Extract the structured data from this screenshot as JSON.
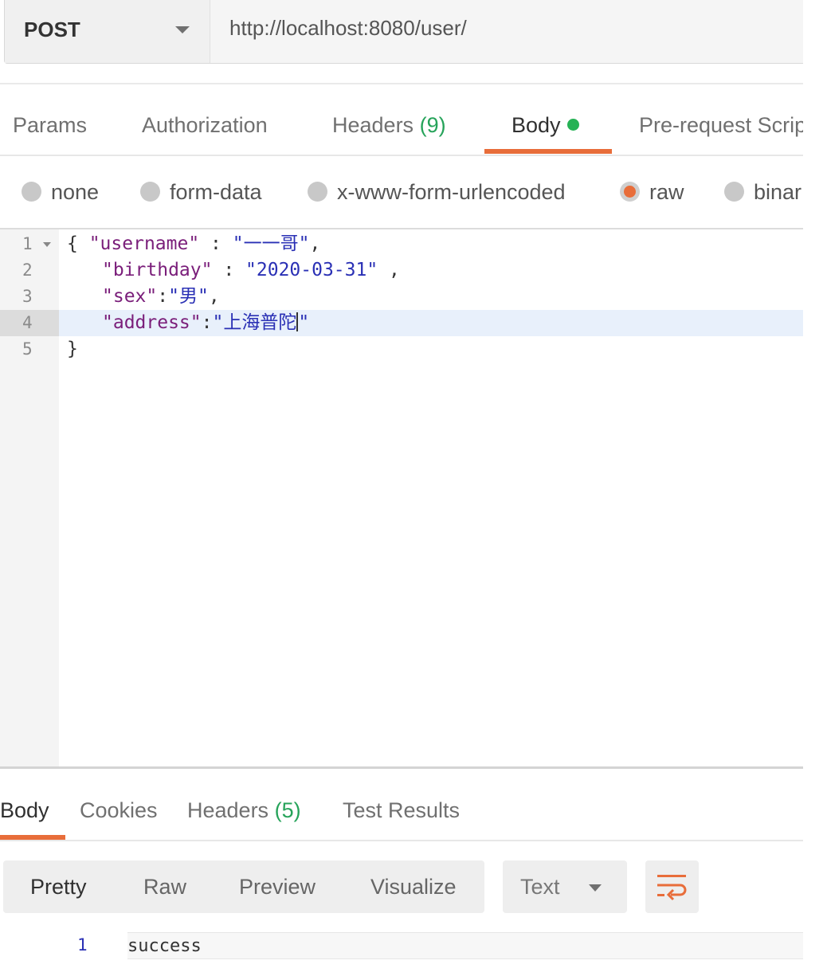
{
  "request": {
    "method": "POST",
    "url": "http://localhost:8080/user/"
  },
  "request_tabs": [
    {
      "label": "Params"
    },
    {
      "label": "Authorization"
    },
    {
      "label": "Headers",
      "count": "(9)"
    },
    {
      "label": "Body",
      "active": true,
      "indicator": "green-dot"
    },
    {
      "label": "Pre-request Scrip"
    }
  ],
  "body_modes": [
    {
      "label": "none"
    },
    {
      "label": "form-data"
    },
    {
      "label": "x-www-form-urlencoded"
    },
    {
      "label": "raw",
      "selected": true
    },
    {
      "label": "binar"
    }
  ],
  "editor": {
    "line_numbers": [
      "1",
      "2",
      "3",
      "4",
      "5"
    ],
    "lines": {
      "l1": {
        "brace": "{ ",
        "key": "\"username\"",
        "sep": " : ",
        "val": "\"一一哥\"",
        "tail": ","
      },
      "l2": {
        "key": "\"birthday\"",
        "sep": " : ",
        "val": "\"2020-03-31\"",
        "tail": " ,"
      },
      "l3": {
        "key": "\"sex\"",
        "sep": ":",
        "val": "\"男\"",
        "tail": ","
      },
      "l4": {
        "key": "\"address\"",
        "sep": ":",
        "val": "\"上海普陀",
        "tail": "\""
      },
      "l5": {
        "brace": "}"
      }
    },
    "active_line": "4"
  },
  "response_tabs": [
    {
      "label": "Body",
      "active": true
    },
    {
      "label": "Cookies"
    },
    {
      "label": "Headers",
      "count": "(5)"
    },
    {
      "label": "Test Results"
    }
  ],
  "response_toolbar": {
    "views": [
      "Pretty",
      "Raw",
      "Preview",
      "Visualize"
    ],
    "active_view": "Pretty",
    "format": "Text",
    "wrap_icon": "wrap-lines-icon"
  },
  "response_body": {
    "line_number": "1",
    "text": "success"
  },
  "colors": {
    "accent": "#e86d3a",
    "count_green": "#26a35a",
    "string_blue": "#2a30b5",
    "key_purple": "#7a1e7a"
  }
}
